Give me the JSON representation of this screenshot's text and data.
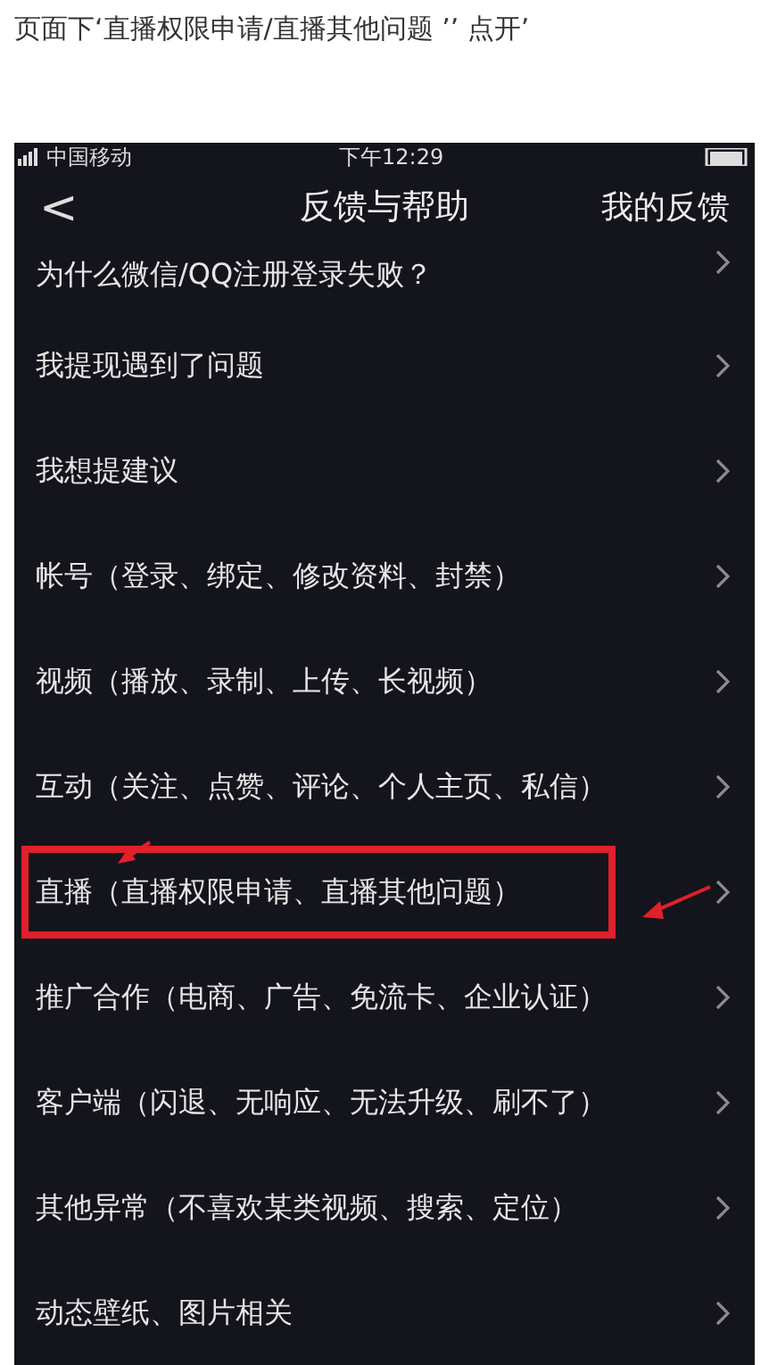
{
  "caption": "页面下‘直播权限申请/直播其他问题 ’’ 点开’",
  "status_bar": {
    "carrier": "中国移动",
    "time": "下午12:29"
  },
  "nav": {
    "back": "<",
    "title": "反馈与帮助",
    "action": "我的反馈"
  },
  "items": [
    {
      "label": "为什么微信/QQ注册登录失败？",
      "highlighted": false
    },
    {
      "label": "我提现遇到了问题",
      "highlighted": false
    },
    {
      "label": "我想提建议",
      "highlighted": false
    },
    {
      "label": "帐号（登录、绑定、修改资料、封禁）",
      "highlighted": false
    },
    {
      "label": "视频（播放、录制、上传、长视频）",
      "highlighted": false
    },
    {
      "label": "互动（关注、点赞、评论、个人主页、私信）",
      "highlighted": false
    },
    {
      "label": "直播（直播权限申请、直播其他问题）",
      "highlighted": true
    },
    {
      "label": "推广合作（电商、广告、免流卡、企业认证）",
      "highlighted": false
    },
    {
      "label": "客户端（闪退、无响应、无法升级、刷不了）",
      "highlighted": false
    },
    {
      "label": "其他异常（不喜欢某类视频、搜索、定位）",
      "highlighted": false
    },
    {
      "label": "动态壁纸、图片相关",
      "highlighted": false
    }
  ]
}
